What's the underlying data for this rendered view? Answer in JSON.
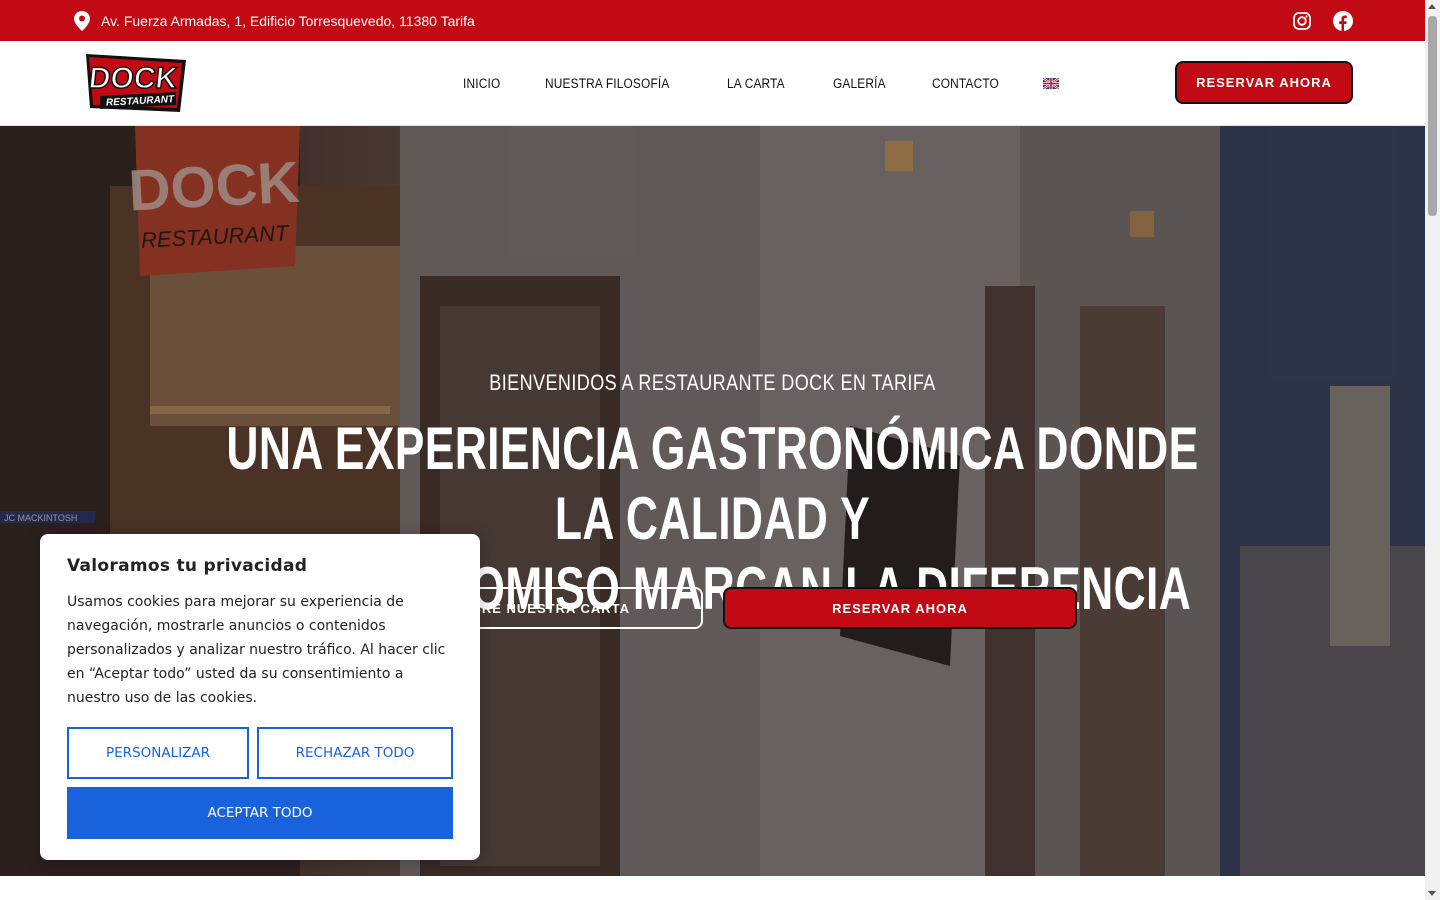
{
  "topbar": {
    "address": "Av. Fuerza Armadas, 1, Edificio Torresquevedo, 11380 Tarifa",
    "icons": {
      "location": "map-pin-icon",
      "instagram": "instagram-icon",
      "facebook": "facebook-icon"
    }
  },
  "header": {
    "logo": {
      "main": "DOCK",
      "sub": "RESTAURANT"
    },
    "nav": [
      "INICIO",
      "NUESTRA FILOSOFÍA",
      "LA CARTA",
      "GALERÍA",
      "CONTACTO"
    ],
    "language_icon": "uk-flag-icon",
    "book_label": "RESERVAR AHORA"
  },
  "hero": {
    "kicker": "BIENVENIDOS A RESTAURANTE DOCK EN TARIFA",
    "headline_line1": "UNA EXPERIENCIA GASTRONÓMICA DONDE LA CALIDAD Y",
    "headline_line2": "EL COMPROMISO MARCAN LA DIFERENCIA",
    "menu_label": "DESCUBRE NUESTRA CARTA",
    "book_label": "RESERVAR AHORA",
    "sign_main": "DOCK",
    "sign_sub": "RESTAURANT",
    "shop_sign": "JC MACKINTOSH"
  },
  "cookie": {
    "title": "Valoramos tu privacidad",
    "body": "Usamos cookies para mejorar su experiencia de navegación, mostrarle anuncios o contenidos personalizados y analizar nuestro tráfico. Al hacer clic en “Aceptar todo” usted da su consentimiento a nuestro uso de las cookies.",
    "customize_label": "PERSONALIZAR",
    "reject_label": "RECHAZAR TODO",
    "accept_label": "ACEPTAR TODO"
  },
  "colors": {
    "brand_red": "#c10a14",
    "cookie_blue": "#1863dc"
  }
}
